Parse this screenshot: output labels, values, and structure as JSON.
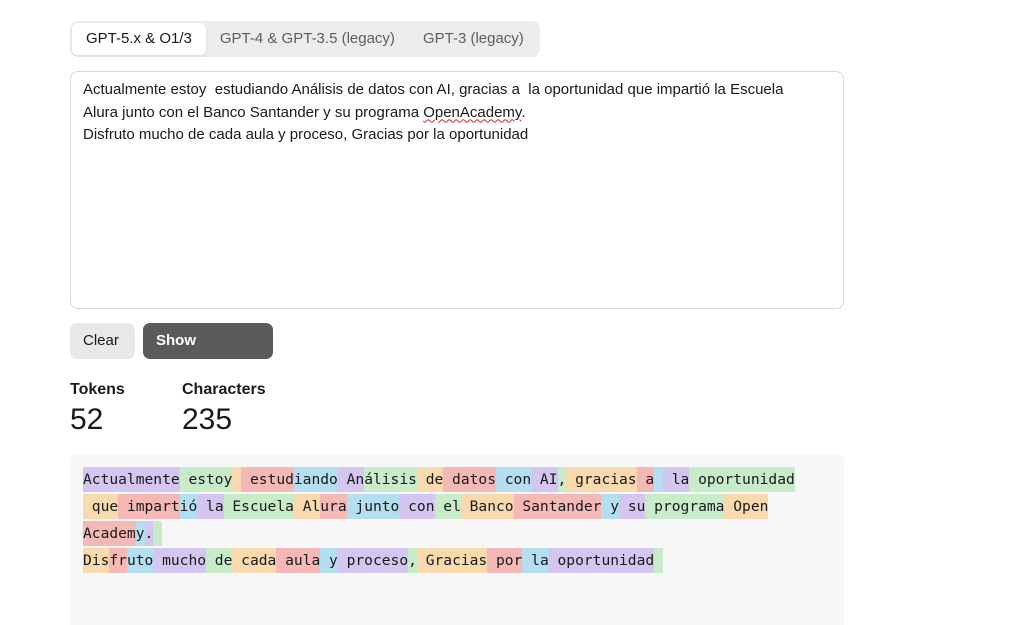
{
  "tabs": [
    {
      "label": "GPT-5.x & O1/3",
      "active": true
    },
    {
      "label": "GPT-4 & GPT-3.5 (legacy)",
      "active": false
    },
    {
      "label": "GPT-3 (legacy)",
      "active": false
    }
  ],
  "input": {
    "line1": "Actualmente estoy  estudiando Análisis de datos con AI, gracias a  la oportunidad que impartió la Escuela",
    "line2_pre": "Alura junto con el Banco Santander y su programa ",
    "line2_misspelled": "OpenAcademy",
    "line2_post": ".",
    "line3": "Disfruto mucho de cada aula y proceso, Gracias por la oportunidad"
  },
  "buttons": {
    "clear": "Clear",
    "show_example": "Show example"
  },
  "stats": {
    "tokens_label": "Tokens",
    "tokens_value": "52",
    "characters_label": "Characters",
    "characters_value": "235"
  },
  "token_colors": [
    "#d4c6f0",
    "#c8ecc9",
    "#f9d9ae",
    "#f4b8b6",
    "#b5dff0"
  ],
  "token_lines": [
    [
      "Actualmente",
      " estoy",
      " ",
      " estud",
      "iando",
      " An",
      "álisis",
      " de",
      " datos",
      " con",
      " AI",
      ",",
      " gracias",
      " a",
      " ",
      " la",
      " oportunidad"
    ],
    [
      " que",
      " impart",
      "ió",
      " la",
      " Escuela",
      " Al",
      "ura",
      " junto",
      " con",
      " el",
      " Banco",
      " Santander",
      " y",
      " su",
      " programa",
      " Open"
    ],
    [
      "Academ",
      "y",
      ".",
      "\n"
    ],
    [
      "Dis",
      "fr",
      "uto",
      " mucho",
      " de",
      " cada",
      " aula",
      " y",
      " proceso",
      ",",
      " Gracias",
      " por",
      " la",
      " oportunidad",
      " "
    ]
  ]
}
